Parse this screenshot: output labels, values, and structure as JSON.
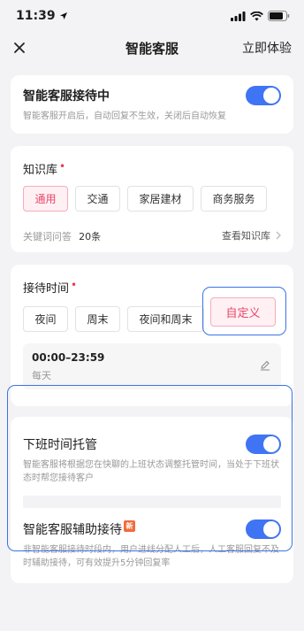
{
  "status_bar": {
    "time": "11:39"
  },
  "navbar": {
    "title": "智能客服",
    "right_action": "立即体验"
  },
  "reception": {
    "title": "智能客服接待中",
    "desc": "智能客服开启后，自动回复不生效，关闭后自动恢复",
    "enabled": true
  },
  "knowledge": {
    "label": "知识库",
    "required_mark": "•",
    "chips": [
      "通用",
      "交通",
      "家居建材",
      "商务服务"
    ],
    "selected": "通用",
    "qa_label": "关键词问答",
    "qa_count": "20条",
    "view_link": "查看知识库"
  },
  "schedule": {
    "label": "接待时间",
    "required_mark": "•",
    "chips": [
      "夜间",
      "周末",
      "夜间和周末",
      "自定义"
    ],
    "selected": "自定义",
    "time_range": "00:00–23:59",
    "repeat": "每天"
  },
  "offwork": {
    "title": "下班时间托管",
    "desc": "智能客服将根据您在快聊的上班状态调整托管时间，当处于下班状态时帮您接待客户",
    "enabled": true
  },
  "assist": {
    "title": "智能客服辅助接待",
    "badge": "新",
    "desc": "非智能客服接待时段内，用户进线分配人工后，人工客服回复不及时辅助接待，可有效提升5分钟回复率",
    "enabled": true
  },
  "colors": {
    "accent": "#3f74f4",
    "pink": "#e7466a",
    "highlight": "#3b74e6"
  }
}
